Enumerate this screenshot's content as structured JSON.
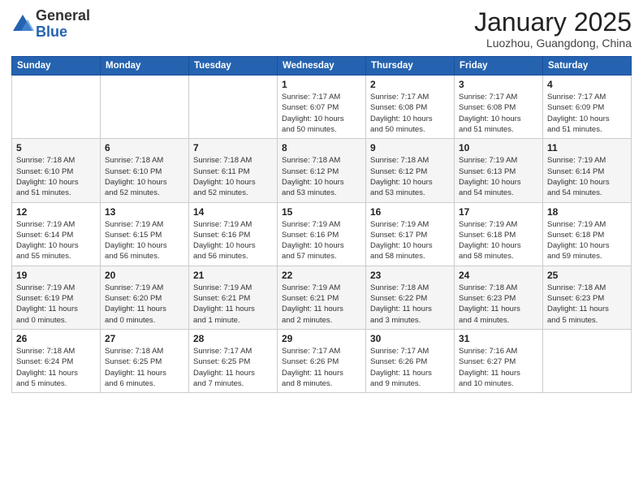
{
  "logo": {
    "general": "General",
    "blue": "Blue"
  },
  "header": {
    "month": "January 2025",
    "location": "Luozhou, Guangdong, China"
  },
  "weekdays": [
    "Sunday",
    "Monday",
    "Tuesday",
    "Wednesday",
    "Thursday",
    "Friday",
    "Saturday"
  ],
  "weeks": [
    [
      {
        "day": "",
        "info": ""
      },
      {
        "day": "",
        "info": ""
      },
      {
        "day": "",
        "info": ""
      },
      {
        "day": "1",
        "info": "Sunrise: 7:17 AM\nSunset: 6:07 PM\nDaylight: 10 hours\nand 50 minutes."
      },
      {
        "day": "2",
        "info": "Sunrise: 7:17 AM\nSunset: 6:08 PM\nDaylight: 10 hours\nand 50 minutes."
      },
      {
        "day": "3",
        "info": "Sunrise: 7:17 AM\nSunset: 6:08 PM\nDaylight: 10 hours\nand 51 minutes."
      },
      {
        "day": "4",
        "info": "Sunrise: 7:17 AM\nSunset: 6:09 PM\nDaylight: 10 hours\nand 51 minutes."
      }
    ],
    [
      {
        "day": "5",
        "info": "Sunrise: 7:18 AM\nSunset: 6:10 PM\nDaylight: 10 hours\nand 51 minutes."
      },
      {
        "day": "6",
        "info": "Sunrise: 7:18 AM\nSunset: 6:10 PM\nDaylight: 10 hours\nand 52 minutes."
      },
      {
        "day": "7",
        "info": "Sunrise: 7:18 AM\nSunset: 6:11 PM\nDaylight: 10 hours\nand 52 minutes."
      },
      {
        "day": "8",
        "info": "Sunrise: 7:18 AM\nSunset: 6:12 PM\nDaylight: 10 hours\nand 53 minutes."
      },
      {
        "day": "9",
        "info": "Sunrise: 7:18 AM\nSunset: 6:12 PM\nDaylight: 10 hours\nand 53 minutes."
      },
      {
        "day": "10",
        "info": "Sunrise: 7:19 AM\nSunset: 6:13 PM\nDaylight: 10 hours\nand 54 minutes."
      },
      {
        "day": "11",
        "info": "Sunrise: 7:19 AM\nSunset: 6:14 PM\nDaylight: 10 hours\nand 54 minutes."
      }
    ],
    [
      {
        "day": "12",
        "info": "Sunrise: 7:19 AM\nSunset: 6:14 PM\nDaylight: 10 hours\nand 55 minutes."
      },
      {
        "day": "13",
        "info": "Sunrise: 7:19 AM\nSunset: 6:15 PM\nDaylight: 10 hours\nand 56 minutes."
      },
      {
        "day": "14",
        "info": "Sunrise: 7:19 AM\nSunset: 6:16 PM\nDaylight: 10 hours\nand 56 minutes."
      },
      {
        "day": "15",
        "info": "Sunrise: 7:19 AM\nSunset: 6:16 PM\nDaylight: 10 hours\nand 57 minutes."
      },
      {
        "day": "16",
        "info": "Sunrise: 7:19 AM\nSunset: 6:17 PM\nDaylight: 10 hours\nand 58 minutes."
      },
      {
        "day": "17",
        "info": "Sunrise: 7:19 AM\nSunset: 6:18 PM\nDaylight: 10 hours\nand 58 minutes."
      },
      {
        "day": "18",
        "info": "Sunrise: 7:19 AM\nSunset: 6:18 PM\nDaylight: 10 hours\nand 59 minutes."
      }
    ],
    [
      {
        "day": "19",
        "info": "Sunrise: 7:19 AM\nSunset: 6:19 PM\nDaylight: 11 hours\nand 0 minutes."
      },
      {
        "day": "20",
        "info": "Sunrise: 7:19 AM\nSunset: 6:20 PM\nDaylight: 11 hours\nand 0 minutes."
      },
      {
        "day": "21",
        "info": "Sunrise: 7:19 AM\nSunset: 6:21 PM\nDaylight: 11 hours\nand 1 minute."
      },
      {
        "day": "22",
        "info": "Sunrise: 7:19 AM\nSunset: 6:21 PM\nDaylight: 11 hours\nand 2 minutes."
      },
      {
        "day": "23",
        "info": "Sunrise: 7:18 AM\nSunset: 6:22 PM\nDaylight: 11 hours\nand 3 minutes."
      },
      {
        "day": "24",
        "info": "Sunrise: 7:18 AM\nSunset: 6:23 PM\nDaylight: 11 hours\nand 4 minutes."
      },
      {
        "day": "25",
        "info": "Sunrise: 7:18 AM\nSunset: 6:23 PM\nDaylight: 11 hours\nand 5 minutes."
      }
    ],
    [
      {
        "day": "26",
        "info": "Sunrise: 7:18 AM\nSunset: 6:24 PM\nDaylight: 11 hours\nand 5 minutes."
      },
      {
        "day": "27",
        "info": "Sunrise: 7:18 AM\nSunset: 6:25 PM\nDaylight: 11 hours\nand 6 minutes."
      },
      {
        "day": "28",
        "info": "Sunrise: 7:17 AM\nSunset: 6:25 PM\nDaylight: 11 hours\nand 7 minutes."
      },
      {
        "day": "29",
        "info": "Sunrise: 7:17 AM\nSunset: 6:26 PM\nDaylight: 11 hours\nand 8 minutes."
      },
      {
        "day": "30",
        "info": "Sunrise: 7:17 AM\nSunset: 6:26 PM\nDaylight: 11 hours\nand 9 minutes."
      },
      {
        "day": "31",
        "info": "Sunrise: 7:16 AM\nSunset: 6:27 PM\nDaylight: 11 hours\nand 10 minutes."
      },
      {
        "day": "",
        "info": ""
      }
    ]
  ]
}
